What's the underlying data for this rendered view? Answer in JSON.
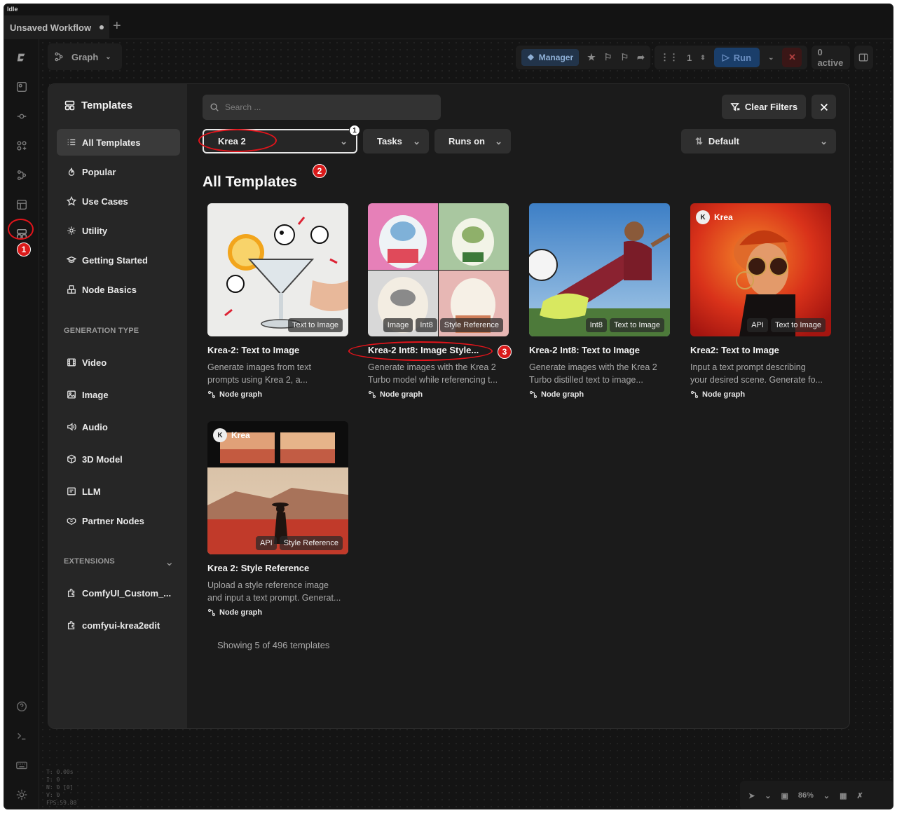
{
  "window": {
    "status": "Idle",
    "tab_title": "Unsaved Workflow",
    "tab_add": "+"
  },
  "topbar": {
    "graph_label": "Graph",
    "manager_label": "Manager",
    "queue_count": "1",
    "run_label": "Run",
    "active_label": "0 active"
  },
  "stats": {
    "lines": [
      "T: 0.00s",
      "I: 0",
      "N: 0 [0]",
      "V: 0",
      "FPS:59.88"
    ]
  },
  "zoom": "86%",
  "modal": {
    "title": "Templates",
    "nav": [
      {
        "label": "All Templates",
        "icon": "list-icon"
      },
      {
        "label": "Popular",
        "icon": "flame-icon"
      },
      {
        "label": "Use Cases",
        "icon": "star-icon"
      },
      {
        "label": "Utility",
        "icon": "gear-icon"
      },
      {
        "label": "Getting Started",
        "icon": "graduation-cap-icon"
      },
      {
        "label": "Node Basics",
        "icon": "blocks-icon"
      }
    ],
    "generation_type_label": "GENERATION TYPE",
    "generation_types": [
      {
        "label": "Video",
        "icon": "film-icon"
      },
      {
        "label": "Image",
        "icon": "image-icon"
      },
      {
        "label": "Audio",
        "icon": "speaker-icon"
      },
      {
        "label": "3D Model",
        "icon": "cube-icon"
      },
      {
        "label": "LLM",
        "icon": "chat-icon"
      },
      {
        "label": "Partner Nodes",
        "icon": "handshake-icon"
      }
    ],
    "extensions_label": "EXTENSIONS",
    "extensions": [
      {
        "label": "ComfyUI_Custom_...",
        "icon": "puzzle-icon"
      },
      {
        "label": "comfyui-krea2edit",
        "icon": "puzzle-icon"
      }
    ],
    "search_placeholder": "Search ...",
    "clear_filters_label": "Clear Filters",
    "filters": {
      "model": "Krea 2",
      "tasks": "Tasks",
      "runs_on": "Runs on",
      "sort": "Default"
    },
    "heading": "All Templates",
    "cards": [
      {
        "title": "Krea-2: Text to Image",
        "desc_lines": [
          "Generate images from text",
          "prompts using Krea 2, a..."
        ],
        "tags": [
          "Text to Image"
        ],
        "meta": "Node graph"
      },
      {
        "title": "Krea-2 Int8: Image Style...",
        "desc_lines": [
          "Generate images with the Krea 2",
          "Turbo model while referencing t..."
        ],
        "tags": [
          "Image",
          "Int8",
          "Style Reference"
        ],
        "meta": "Node graph"
      },
      {
        "title": "Krea-2 Int8: Text to Image",
        "desc_lines": [
          "Generate images with the Krea 2",
          "Turbo distilled text to image..."
        ],
        "tags": [
          "Int8",
          "Text to Image"
        ],
        "meta": "Node graph"
      },
      {
        "title": "Krea2: Text to Image",
        "desc_lines": [
          "Input a text prompt describing",
          "your desired scene. Generate fo..."
        ],
        "tags": [
          "API",
          "Text to Image"
        ],
        "badge": "Krea",
        "meta": "Node graph"
      },
      {
        "title": "Krea 2: Style Reference",
        "desc_lines": [
          "Upload a style reference image",
          "and input a text prompt. Generat..."
        ],
        "tags": [
          "API",
          "Style Reference"
        ],
        "badge": "Krea",
        "meta": "Node graph"
      }
    ],
    "count_text": "Showing 5 of 496 templates"
  },
  "annotations": [
    "1",
    "2",
    "3",
    "1"
  ],
  "colors": {
    "annotation_red": "#e2141b",
    "run_blue": "#1a3e6a",
    "modal_bg": "#1b1b1b",
    "sidebar_bg": "#262626"
  }
}
